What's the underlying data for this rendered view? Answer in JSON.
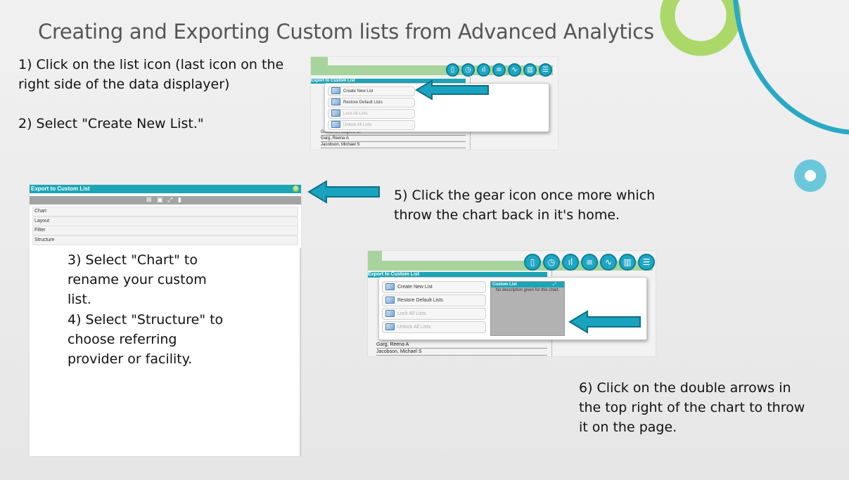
{
  "title": "Creating and Exporting Custom lists from Advanced Analytics",
  "steps": {
    "s1": "1) Click on the list icon (last icon on the right side of the data displayer)",
    "s2": "2) Select \"Create New List.\"",
    "s3": "3) Select \"Chart\" to rename your custom list.",
    "s4": "4) Select \"Structure\" to choose referring provider or facility.",
    "s5": "5) Click the gear icon once more which throw the chart back in it's home.",
    "s6": "6) Click on the double arrows in the top right of the chart to throw it on the page."
  },
  "screenshot1": {
    "header": "Export to Custom List",
    "menu": [
      "Create New List",
      "Restore Default Lists",
      "Lock All Lists",
      "Unlock All Lists"
    ],
    "rows": [
      "Gaudinier, Eugene B.",
      "Garg, Reena A",
      "Jacobson, Michael S"
    ]
  },
  "screenshot2": {
    "header": "Export to Custom List",
    "items": [
      "Chart",
      "Layout",
      "Filter",
      "Structure"
    ]
  },
  "screenshot3": {
    "header": "Export to Custom List",
    "menu": [
      "Create New List",
      "Restore Default Lists",
      "Lock All Lists",
      "Unlock All Lists"
    ],
    "panel_title": "Custom List",
    "panel_desc": "No description given for this chart.",
    "rows": [
      "Garg, Reena A",
      "Jacobson, Michael S"
    ]
  },
  "colors": {
    "accent": "#1ca5b7",
    "green_ring": "#9ed15a",
    "teal": "#25a5c2",
    "arrow": "#1aa3bf"
  }
}
